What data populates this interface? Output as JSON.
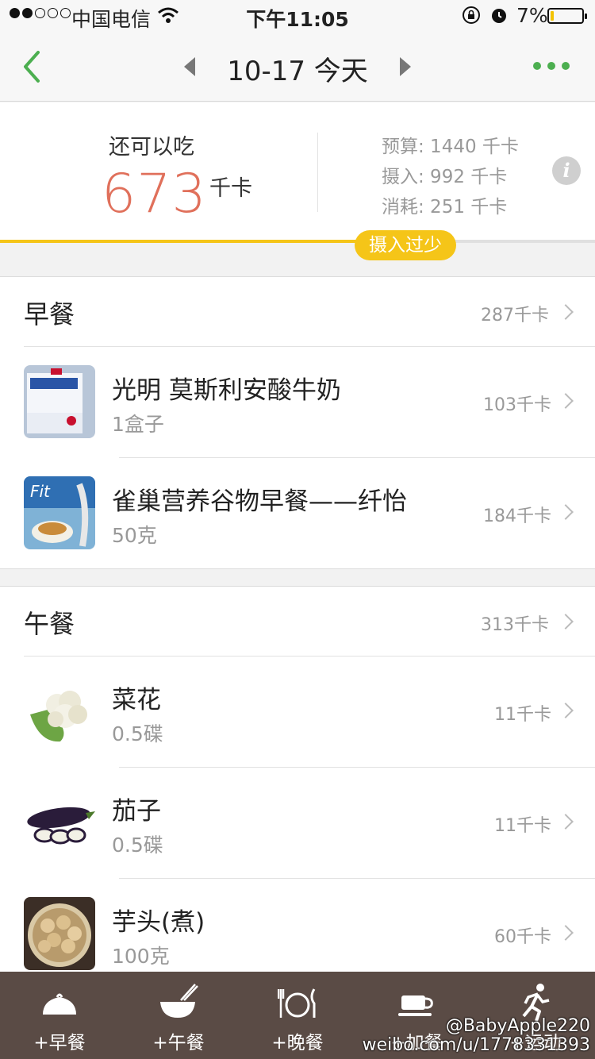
{
  "status_bar": {
    "carrier": "中国电信",
    "time": "下午11:05",
    "battery": "7%"
  },
  "nav": {
    "date": "10-17 今天"
  },
  "summary": {
    "remaining_label": "还可以吃",
    "remaining_value": "673",
    "remaining_unit": "千卡",
    "budget": "预算: 1440 千卡",
    "intake": "摄入: 992 千卡",
    "burned": "消耗: 251 千卡",
    "intake_ratio": 0.69,
    "badge": "摄入过少"
  },
  "breakfast": {
    "title": "早餐",
    "kcal": "287千卡",
    "items": [
      {
        "name": "光明 莫斯利安酸牛奶",
        "qty": "1盒子",
        "kcal": "103千卡"
      },
      {
        "name": "雀巢营养谷物早餐——纤怡",
        "qty": "50克",
        "kcal": "184千卡"
      }
    ]
  },
  "lunch": {
    "title": "午餐",
    "kcal": "313千卡",
    "items": [
      {
        "name": "菜花",
        "qty": "0.5碟",
        "kcal": "11千卡"
      },
      {
        "name": "茄子",
        "qty": "0.5碟",
        "kcal": "11千卡"
      },
      {
        "name": "芋头(煮)",
        "qty": "100克",
        "kcal": "60千卡"
      }
    ]
  },
  "tabbar": {
    "tabs": [
      "+早餐",
      "+午餐",
      "+晚餐",
      "+加餐",
      "+运动"
    ]
  },
  "watermark": {
    "line1": "@BabyApple220",
    "line2": "weibo.com/u/1778331393"
  },
  "colors": {
    "accent_green": "#4caf50",
    "remaining_red": "#e0705b",
    "badge_yellow": "#f5c518",
    "tabbar_brown": "#5a4b45"
  }
}
